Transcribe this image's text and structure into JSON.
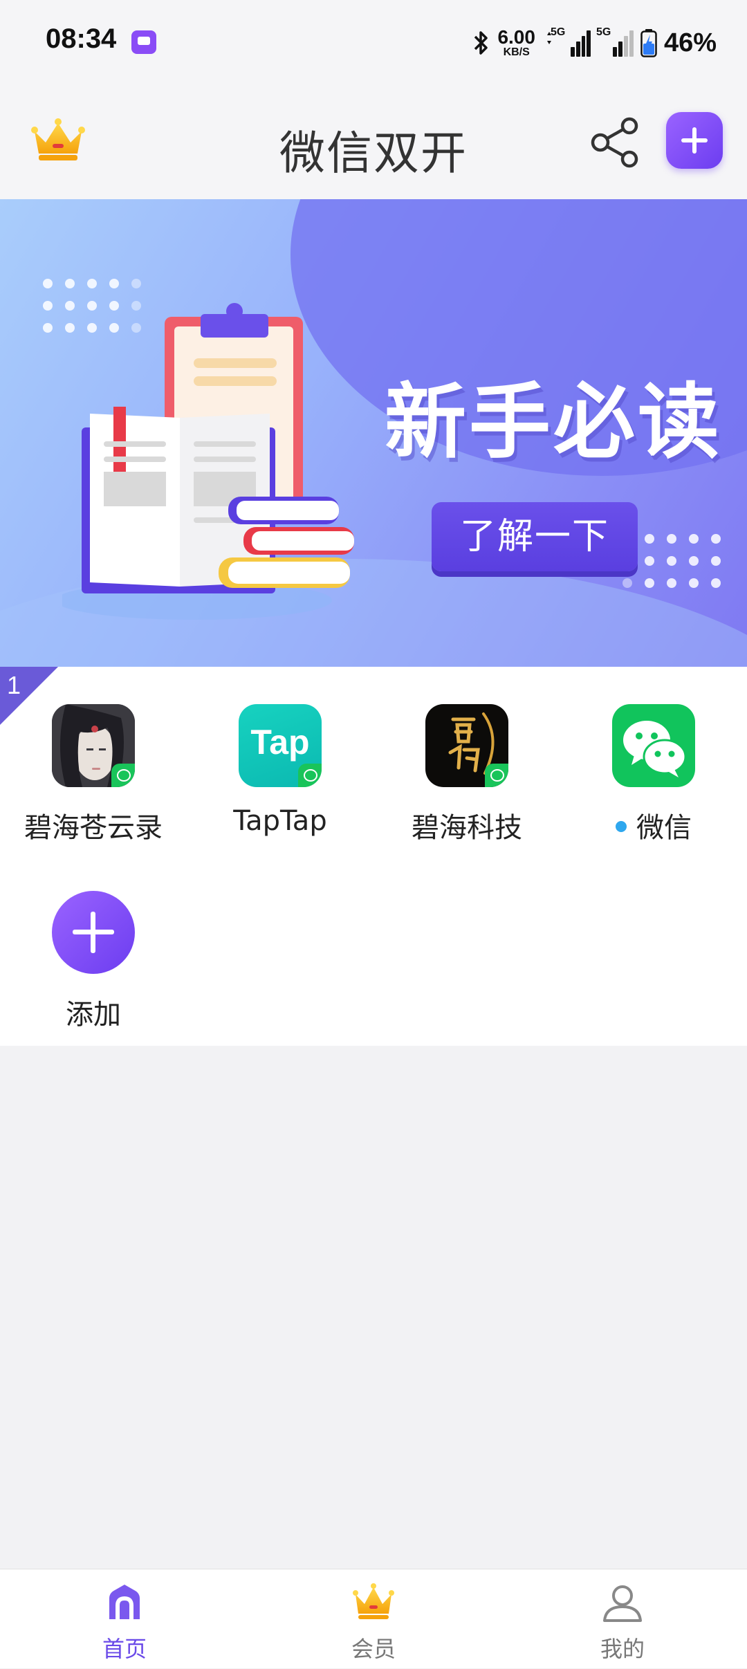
{
  "status_bar": {
    "time": "08:34",
    "net_speed_value": "6.00",
    "net_speed_unit": "KB/S",
    "signal_1_label": "5G",
    "signal_2_label": "5G",
    "battery": "46%"
  },
  "header": {
    "title": "微信双开",
    "crown_icon": "crown-icon",
    "share_icon": "share-icon",
    "add_icon": "plus-icon"
  },
  "banner": {
    "headline": "新手必读",
    "cta_label": "了解一下",
    "colors": {
      "accent": "#5a3fe0",
      "bg_start": "#a9cdfb",
      "bg_end": "#7f79f2"
    }
  },
  "app_grid": {
    "corner_badge": "1",
    "apps": [
      {
        "label": "碧海苍云录",
        "icon": "character-portrait-icon",
        "has_wechat_badge": true
      },
      {
        "label": "TapTap",
        "icon": "taptap-icon",
        "icon_text": "Tap",
        "has_wechat_badge": true
      },
      {
        "label": "碧海科技",
        "icon": "calligraphy-logo-icon",
        "has_wechat_badge": true
      },
      {
        "label": "微信",
        "icon": "wechat-icon",
        "has_dot": true,
        "dot_color": "#2ea7ee"
      }
    ],
    "add_item": {
      "label": "添加",
      "icon": "plus-icon"
    }
  },
  "bottom_nav": {
    "items": [
      {
        "label": "首页",
        "icon": "home-icon",
        "active": true
      },
      {
        "label": "会员",
        "icon": "crown-icon",
        "active": false
      },
      {
        "label": "我的",
        "icon": "user-icon",
        "active": false
      }
    ],
    "active_color": "#6a4ae8"
  }
}
